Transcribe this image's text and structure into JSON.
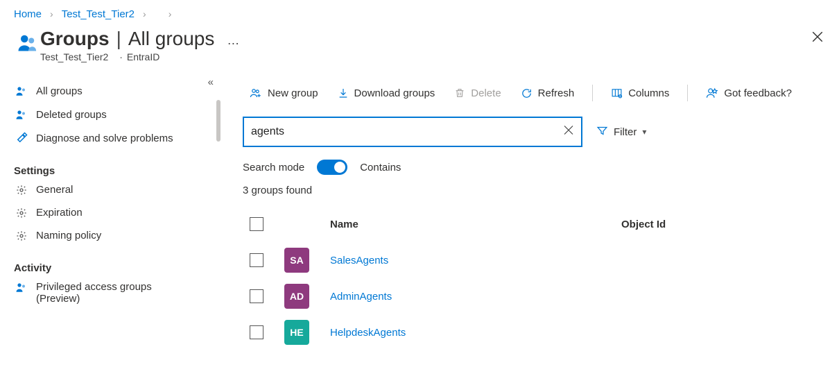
{
  "breadcrumb": [
    {
      "label": "Home"
    },
    {
      "label": "Test_Test_Tier2"
    }
  ],
  "header": {
    "title": "Groups",
    "divider": "|",
    "subtitle": "All groups",
    "tenant": "Test_Test_Tier2",
    "product": "EntraID"
  },
  "sidebar": {
    "nav": [
      {
        "icon": "groups",
        "label": "All groups"
      },
      {
        "icon": "groups",
        "label": "Deleted groups"
      },
      {
        "icon": "wrench",
        "label": "Diagnose and solve problems"
      }
    ],
    "settings_header": "Settings",
    "settings": [
      {
        "icon": "gear",
        "label": "General"
      },
      {
        "icon": "gear",
        "label": "Expiration"
      },
      {
        "icon": "gear",
        "label": "Naming policy"
      }
    ],
    "activity_header": "Activity",
    "activity": [
      {
        "icon": "groups",
        "label": "Privileged access groups (Preview)"
      }
    ]
  },
  "toolbar": {
    "new_group": "New group",
    "download": "Download groups",
    "delete": "Delete",
    "refresh": "Refresh",
    "columns": "Columns",
    "feedback": "Got feedback?"
  },
  "search": {
    "value": "agents",
    "mode_label": "Search mode",
    "mode_value": "Contains",
    "filter_label": "Filter"
  },
  "results": {
    "count_label": "3 groups found",
    "columns": {
      "name": "Name",
      "object_id": "Object Id"
    },
    "rows": [
      {
        "initials": "SA",
        "name": "SalesAgents",
        "color": "#8e3a7e"
      },
      {
        "initials": "AD",
        "name": "AdminAgents",
        "color": "#8e3a7e"
      },
      {
        "initials": "HE",
        "name": "HelpdeskAgents",
        "color": "#16a99b"
      }
    ]
  }
}
